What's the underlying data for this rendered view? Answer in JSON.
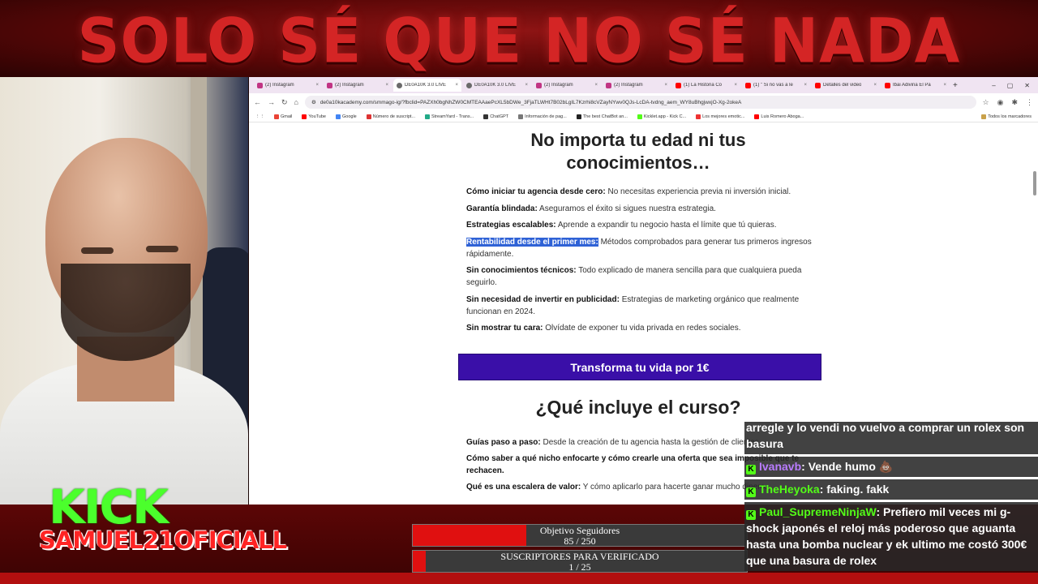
{
  "banner": {
    "title": "SOLO SÉ QUE NO SÉ NADA"
  },
  "overlay": {
    "kick_logo": "KICK",
    "username": "SAMUEL21OFICIALL"
  },
  "browser": {
    "tabs": [
      {
        "label": "(2) Instagram",
        "icon": "instagram-icon"
      },
      {
        "label": "(2) Instagram",
        "icon": "instagram-icon"
      },
      {
        "label": "DE0A10K 3.0 LIVE",
        "icon": "globe-icon",
        "active": true
      },
      {
        "label": "DE0A10K 3.0 LIVE",
        "icon": "globe-icon"
      },
      {
        "label": "(2) Instagram",
        "icon": "instagram-icon"
      },
      {
        "label": "(2) Instagram",
        "icon": "instagram-icon"
      },
      {
        "label": "(1) La Historia Co",
        "icon": "youtube-icon"
      },
      {
        "label": "(1) \" Si no vas a le",
        "icon": "youtube-icon"
      },
      {
        "label": "Detalles del video",
        "icon": "youtube-icon"
      },
      {
        "label": "Ibai Adivina El Pa",
        "icon": "youtube-icon"
      }
    ],
    "url": "de0a10kacademy.com/smmago-ig/?fbclid=PAZXh0bgNhZW0CMTEAAaePcXL5bDWe_3FjaTLWHt7B02bLgIL7Kzrhi8cVZayNYwv0QJs-LcDA-tvdng_aem_WY8uBhgjwxjO-Xg-2okeA",
    "bookmarks": [
      "Gmail",
      "YouTube",
      "Google",
      "Número de suscript...",
      "StreamYard - Trans...",
      "ChatGPT",
      "Información de pag...",
      "The best ChatBot an...",
      "Kicklet.app - Kick C...",
      "Los mejores emotic...",
      "Luis Romero Aboga..."
    ],
    "all_bookmarks": "Todos los marcadores"
  },
  "page": {
    "heading": "No importa tu edad ni tus conocimientos…",
    "features": [
      {
        "title": "Cómo iniciar tu agencia desde cero:",
        "text": " No necesitas experiencia previa ni inversión inicial."
      },
      {
        "title": "Garantía blindada:",
        "text": " Aseguramos el éxito si sigues nuestra estrategia."
      },
      {
        "title": "Estrategias escalables:",
        "text": " Aprende a expandir tu negocio hasta el límite que tú quieras."
      },
      {
        "title": "Rentabilidad desde el primer mes:",
        "text": " Métodos comprobados para generar tus primeros ingresos rápidamente."
      },
      {
        "title": "Sin conocimientos técnicos:",
        "text": " Todo explicado de manera sencilla para que cualquiera pueda seguirlo."
      },
      {
        "title": "Sin necesidad de invertir en publicidad:",
        "text": " Estrategias de marketing orgánico que realmente funcionan en 2024."
      },
      {
        "title": "Sin mostrar tu cara:",
        "text": " Olvídate de exponer tu vida privada en redes sociales."
      }
    ],
    "cta": "Transforma tu vida por 1€",
    "heading2": "¿Qué incluye el curso?",
    "includes": [
      {
        "title": "Guías paso a paso:",
        "text": " Desde la creación de tu agencia hasta la gestión de clientes."
      },
      {
        "title": "Cómo saber a qué nicho enfocarte y cómo crearle una oferta que sea imposible que te rechacen.",
        "text": ""
      },
      {
        "title": "Qué es una escalera de valor:",
        "text": " Y cómo aplicarlo para hacerte ganar mucho dinero."
      }
    ]
  },
  "chat": [
    {
      "user": "",
      "text": "arregle y lo vendi no vuelvo a comprar un rolex son basura"
    },
    {
      "user": "Ivanavb",
      "text": ": Vende humo 💩"
    },
    {
      "user": "TheHeyoka",
      "text": ": faking. fakk"
    },
    {
      "user": "Paul_SupremeNinjaW",
      "text": ": Prefiero mil veces mi g-shock japonés el reloj más poderoso que aguanta hasta una bomba nuclear y ek ultimo me costó 300€ que una basura de rolex"
    }
  ],
  "goals": [
    {
      "label": "Objetivo Seguidores",
      "value": "85 / 250",
      "progress": 0.34
    },
    {
      "label": "SUSCRIPTORES PARA VERIFICADO",
      "value": "1 / 25",
      "progress": 0.04
    }
  ],
  "colors": {
    "banner_red": "#d42525",
    "kick_green": "#53fc18",
    "cta_purple": "#3a0fa8",
    "bar_red": "#e01010"
  }
}
